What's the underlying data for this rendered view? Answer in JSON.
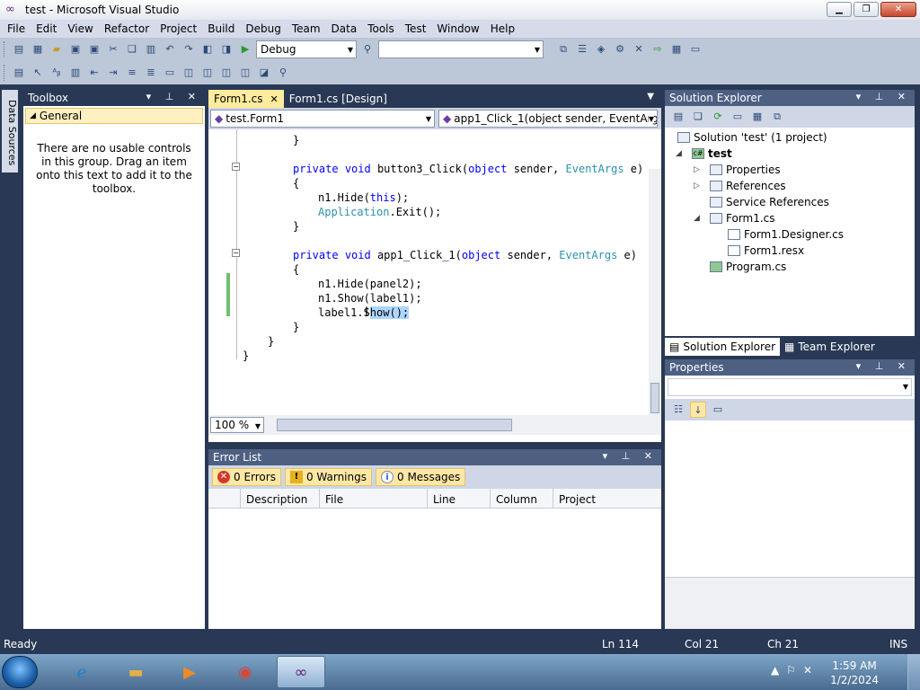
{
  "window": {
    "title": "test - Microsoft Visual Studio"
  },
  "menu": [
    "File",
    "Edit",
    "View",
    "Refactor",
    "Project",
    "Build",
    "Debug",
    "Team",
    "Data",
    "Tools",
    "Test",
    "Window",
    "Help"
  ],
  "toolbar": {
    "config": "Debug",
    "find_value": ""
  },
  "side_strip": {
    "data_sources_label": "Data Sources"
  },
  "toolbox": {
    "title": "Toolbox",
    "group": "General",
    "message": "There are no usable controls in this group. Drag an item onto this text to add it to the toolbox."
  },
  "editor": {
    "tabs": [
      {
        "label": "Form1.cs",
        "active": true
      },
      {
        "label": "Form1.cs [Design]",
        "active": false
      }
    ],
    "class_combo": "test.Form1",
    "member_combo": "app1_Click_1(object sender, EventArgs e)",
    "zoom": "100 %",
    "code": {
      "l1_brace": "}",
      "l2_kw1": "private",
      "l2_kw2": "void",
      "l2_name": "button3_Click(",
      "l2_kw3": "object",
      "l2_rest": "sender,",
      "l2_type": "EventArgs",
      "l2_end": "e)",
      "l3": "{",
      "l4a": "n1.Hide(",
      "l4b": "this",
      "l4c": ");",
      "l5a": "Application",
      "l5b": ".Exit();",
      "l6": "}",
      "l7_kw1": "private",
      "l7_kw2": "void",
      "l7_name": "app1_Click_1(",
      "l7_kw3": "object",
      "l7_rest": "sender,",
      "l7_type": "EventArgs",
      "l7_end": "e)",
      "l8": "{",
      "l9": "n1.Hide(panel2);",
      "l10": "n1.Show(label1);",
      "l11a": "label1.S",
      "l11b": "how();",
      "l12": "}",
      "l13": "}",
      "l14": "}"
    }
  },
  "error_list": {
    "title": "Error List",
    "errors": "0 Errors",
    "warnings": "0 Warnings",
    "messages": "0 Messages",
    "columns": [
      "Description",
      "File",
      "Line",
      "Column",
      "Project"
    ]
  },
  "solution_explorer": {
    "title": "Solution Explorer",
    "solution": "Solution 'test' (1 project)",
    "project": "test",
    "items": [
      "Properties",
      "References",
      "Service References",
      "Form1.cs",
      "Form1.Designer.cs",
      "Form1.resx",
      "Program.cs"
    ],
    "bottom_tabs": [
      "Solution Explorer",
      "Team Explorer"
    ]
  },
  "properties": {
    "title": "Properties"
  },
  "status": {
    "left": "Ready",
    "ln": "Ln 114",
    "col": "Col 21",
    "ch": "Ch 21",
    "ins": "INS"
  },
  "taskbar": {
    "time": "1:59 AM",
    "date": "1/2/2024"
  },
  "colors": {
    "accent": "#293955",
    "tab_active": "#ffeb9c",
    "keyword": "#0000ff",
    "type": "#2b91af"
  }
}
